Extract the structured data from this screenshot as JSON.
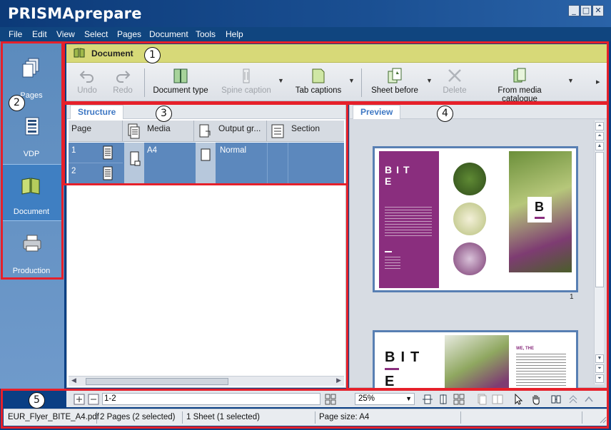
{
  "window": {
    "title": "PRISMAprepare",
    "controls": [
      "minimize",
      "maximize",
      "close"
    ]
  },
  "menubar": {
    "items": [
      "File",
      "Edit",
      "View",
      "Select",
      "Pages",
      "Document",
      "Tools",
      "Help"
    ]
  },
  "leftnav": {
    "items": [
      {
        "label": "Pages",
        "icon": "pages-icon",
        "active": false
      },
      {
        "label": "VDP",
        "icon": "vdp-icon",
        "active": false
      },
      {
        "label": "Document",
        "icon": "document-book-icon",
        "active": true
      },
      {
        "label": "Production",
        "icon": "printer-icon",
        "active": false
      }
    ]
  },
  "document_header": {
    "title": "Document"
  },
  "toolbar": {
    "undo": "Undo",
    "redo": "Redo",
    "document_type": "Document type",
    "spine_caption": "Spine caption",
    "tab_captions": "Tab captions",
    "sheet_before": "Sheet before",
    "delete": "Delete",
    "from_media_catalogue": "From media catalogue",
    "more": "▸"
  },
  "structure": {
    "tab_label": "Structure",
    "columns": [
      "Page",
      "Media",
      "Output gr...",
      "Section"
    ],
    "rows": [
      {
        "page": "1",
        "media": "A4",
        "output": "Normal"
      },
      {
        "page": "2",
        "media": "",
        "output": ""
      }
    ]
  },
  "preview": {
    "tab_label": "Preview",
    "page1_number": "1",
    "page1": {
      "title_letters": [
        "B",
        "I",
        "T",
        "E"
      ],
      "logo_letter": "B"
    },
    "page2": {
      "title_letters": [
        "B",
        "I",
        "T",
        "E"
      ],
      "heading": "WE, THE"
    }
  },
  "bottombar": {
    "page_range": "1-2",
    "zoom": "25%"
  },
  "statusbar": {
    "file": "EUR_Flyer_BITE_A4.pdf",
    "pages": "2 Pages (2 selected)",
    "sheets": "1 Sheet (1 selected)",
    "page_size": "Page size: A4"
  },
  "callouts": [
    "1",
    "2",
    "3",
    "4",
    "5"
  ],
  "colors": {
    "accent_red": "#e6202a",
    "header_yellow": "#d7d978",
    "nav_active": "#3f7fc2",
    "selected_row": "#5c88bd",
    "bite_purple": "#8a2e7e"
  }
}
